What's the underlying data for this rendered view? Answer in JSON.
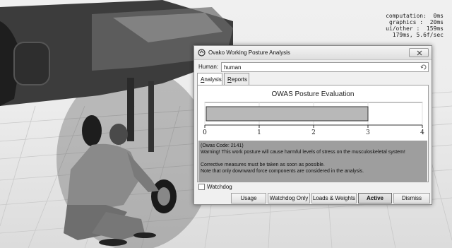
{
  "stats": {
    "lines": [
      "computation:  0ms",
      "graphics :  20ms",
      "ui/other :  159ms",
      "179ms, 5.6f/sec"
    ]
  },
  "dialog": {
    "title": "Ovako Working Posture Analysis",
    "icon": "app-icon",
    "human_label": "Human:",
    "human_value": "human",
    "tabs": [
      {
        "label": "Analysis",
        "underline": "A",
        "rest": "nalysis",
        "active": true
      },
      {
        "label": "Reports",
        "underline": "R",
        "rest": "eports",
        "active": false
      }
    ],
    "chart_data": {
      "type": "bar",
      "title": "OWAS Posture Evaluation",
      "values": [
        3
      ],
      "xlim": [
        0,
        4
      ],
      "x_ticks": [
        "0",
        "1",
        "2",
        "3",
        "4"
      ],
      "bar_color": "#b8b8b8",
      "grid": true
    },
    "messages": [
      "(Owas Code: 2141)",
      "Warning! This work posture will cause harmful levels of stress on the musculoskeletal system!",
      "",
      "Corrective measures must be taken as soon as possible.",
      "Note that only downward force components are considered in the analysis."
    ],
    "watchdog_label": "Watchdog",
    "watchdog_checked": false,
    "buttons": {
      "usage": "Usage",
      "watchdog_only": "Watchdog Only",
      "loads_weights": "Loads & Weights",
      "active": "Active",
      "dismiss": "Dismiss"
    }
  }
}
